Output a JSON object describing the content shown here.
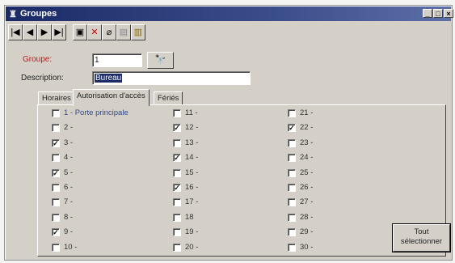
{
  "window": {
    "title": "Groupes",
    "controls": [
      "_",
      "□",
      "×"
    ]
  },
  "toolbar": {
    "buttons": [
      {
        "name": "first-record",
        "glyph": "|◀"
      },
      {
        "name": "previous-record",
        "glyph": "◀"
      },
      {
        "name": "next-record",
        "glyph": "▶"
      },
      {
        "name": "last-record",
        "glyph": "▶|"
      },
      {
        "name": "save",
        "glyph": "▣"
      },
      {
        "name": "delete",
        "glyph": "✕"
      },
      {
        "name": "eraser",
        "glyph": "⌀"
      },
      {
        "name": "find",
        "glyph": "▤"
      },
      {
        "name": "exit",
        "glyph": "▥"
      }
    ]
  },
  "form": {
    "groupe_label": "Groupe:",
    "groupe_value": "1",
    "description_label": "Description:",
    "description_value": "Bureau",
    "find_button_glyph": "🔭"
  },
  "tabs": [
    {
      "label": "Horaires",
      "active": false
    },
    {
      "label": "Autorisation d'accès",
      "active": true
    },
    {
      "label": "Fériés",
      "active": false
    }
  ],
  "doors": [
    {
      "label": "1 - Porte principale",
      "checked": false
    },
    {
      "label": "2 -",
      "checked": false
    },
    {
      "label": "3 -",
      "checked": true
    },
    {
      "label": "4 -",
      "checked": false
    },
    {
      "label": "5 -",
      "checked": true
    },
    {
      "label": "6 -",
      "checked": false
    },
    {
      "label": "7 -",
      "checked": false
    },
    {
      "label": "8 -",
      "checked": false
    },
    {
      "label": "9 -",
      "checked": true
    },
    {
      "label": "10 -",
      "checked": false
    },
    {
      "label": "11 -",
      "checked": false
    },
    {
      "label": "12 -",
      "checked": true
    },
    {
      "label": "13 -",
      "checked": false
    },
    {
      "label": "14 -",
      "checked": true
    },
    {
      "label": "15 -",
      "checked": false
    },
    {
      "label": "16 -",
      "checked": true
    },
    {
      "label": "17 -",
      "checked": false
    },
    {
      "label": "18",
      "checked": false
    },
    {
      "label": "19 -",
      "checked": false
    },
    {
      "label": "20 -",
      "checked": false
    },
    {
      "label": "21 -",
      "checked": false
    },
    {
      "label": "22 -",
      "checked": true
    },
    {
      "label": "23 -",
      "checked": false
    },
    {
      "label": "24 -",
      "checked": false
    },
    {
      "label": "25 -",
      "checked": false
    },
    {
      "label": "26 -",
      "checked": false
    },
    {
      "label": "27 -",
      "checked": false
    },
    {
      "label": "28 -",
      "checked": false
    },
    {
      "label": "29 -",
      "checked": false
    },
    {
      "label": "30 -",
      "checked": false
    }
  ],
  "select_all_label": "Tout sélectionner",
  "colors": {
    "titlebar": "#1b2a66",
    "label_red": "#b22222",
    "selection": "#1b2a66"
  }
}
